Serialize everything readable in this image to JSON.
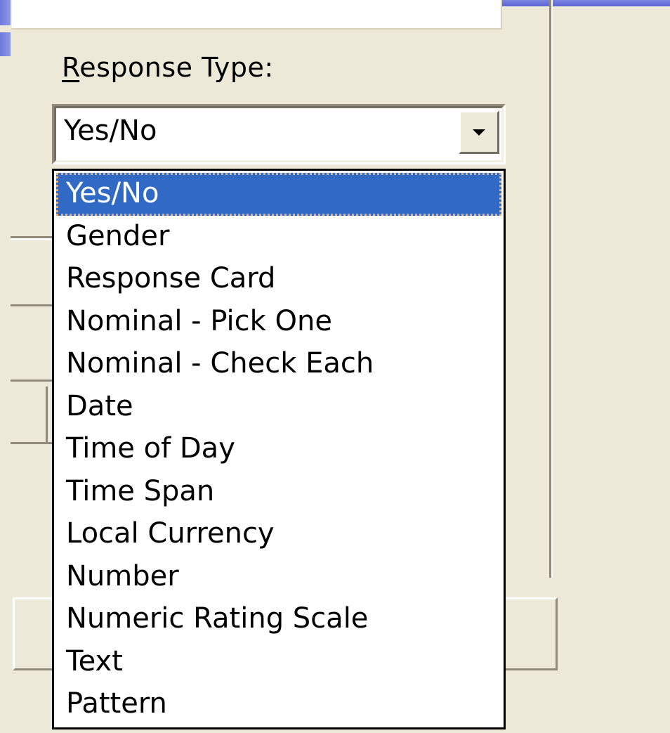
{
  "response_type": {
    "label_mnemonic": "R",
    "label_rest": "esponse Type:",
    "selected_value": "Yes/No",
    "options": [
      "Yes/No",
      "Gender",
      "Response Card",
      "Nominal - Pick One",
      "Nominal - Check Each",
      "Date",
      "Time of Day",
      "Time Span",
      "Local Currency",
      "Number",
      "Numeric Rating Scale",
      "Text",
      "Pattern"
    ],
    "highlighted_index": 0
  },
  "icons": {
    "dropdown_arrow": "chevron-down-icon"
  },
  "colors": {
    "window_bg": "#ECE9D8",
    "selection_bg": "#316AC5",
    "selection_text": "#FFFFFF",
    "title_bar": "#6D79DD"
  }
}
